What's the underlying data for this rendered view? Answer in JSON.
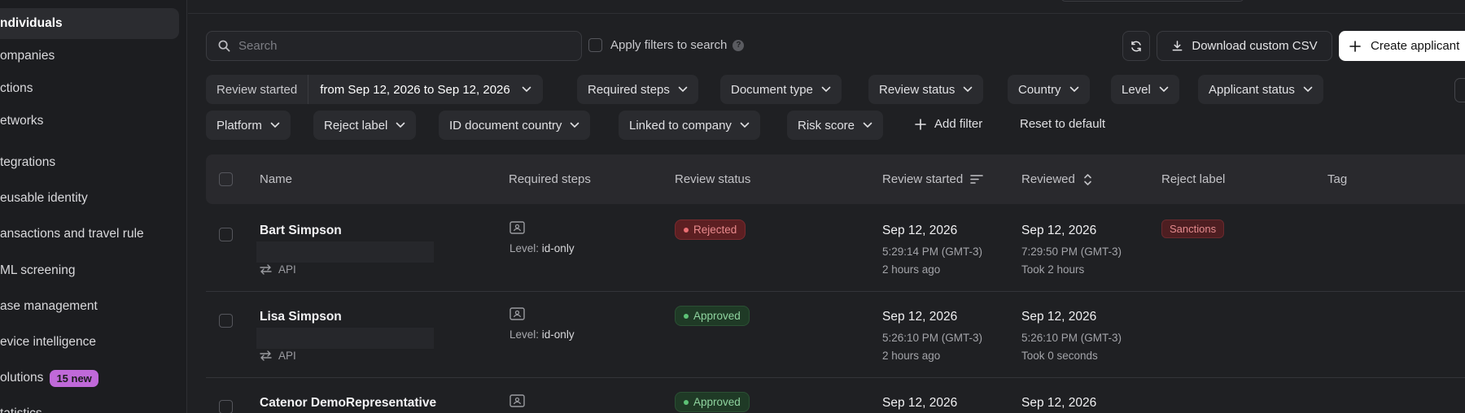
{
  "sidebar": {
    "items": [
      {
        "label": "ndividuals",
        "active": true
      },
      {
        "label": "ompanies"
      },
      {
        "label": "ctions"
      },
      {
        "label": "etworks"
      },
      {
        "label": "tegrations"
      },
      {
        "label": "eusable identity"
      },
      {
        "label": "ansactions and travel rule"
      },
      {
        "label": "ML screening"
      },
      {
        "label": "ase management"
      },
      {
        "label": "evice intelligence"
      },
      {
        "label": "olutions",
        "badge": "15 new"
      },
      {
        "label": "tatistics"
      }
    ]
  },
  "toolbar": {
    "search_placeholder": "Search",
    "apply_filters_label": "Apply filters to search",
    "download_label": "Download custom CSV",
    "create_label": "Create applicant"
  },
  "filters": {
    "review_started_label": "Review started",
    "review_started_value": "from Sep 12, 2026 to Sep 12, 2026",
    "row1": [
      "Required steps",
      "Document type",
      "Review status",
      "Country",
      "Level",
      "Applicant status"
    ],
    "row2": [
      "Platform",
      "Reject label",
      "ID document country",
      "Linked to company",
      "Risk score"
    ],
    "add_filter": "Add filter",
    "reset": "Reset to default"
  },
  "table": {
    "headers": {
      "name": "Name",
      "required_steps": "Required steps",
      "review_status": "Review status",
      "review_started": "Review started",
      "reviewed": "Reviewed",
      "reject_label": "Reject label",
      "tag": "Tag"
    },
    "rows": [
      {
        "name": "Bart Simpson",
        "source": "API",
        "level_label": "Level:",
        "level": "id-only",
        "status": "Rejected",
        "started_date": "Sep 12, 2026",
        "started_time": "5:29:14 PM (GMT-3)",
        "started_ago": "2 hours ago",
        "reviewed_date": "Sep 12, 2026",
        "reviewed_time": "7:29:50 PM (GMT-3)",
        "reviewed_took": "Took 2 hours",
        "reject_label": "Sanctions"
      },
      {
        "name": "Lisa Simpson",
        "source": "API",
        "level_label": "Level:",
        "level": "id-only",
        "status": "Approved",
        "started_date": "Sep 12, 2026",
        "started_time": "5:26:10 PM (GMT-3)",
        "started_ago": "2 hours ago",
        "reviewed_date": "Sep 12, 2026",
        "reviewed_time": "5:26:10 PM (GMT-3)",
        "reviewed_took": "Took 0 seconds"
      },
      {
        "name": "Catenor DemoRepresentative",
        "status": "Approved",
        "started_date": "Sep 12, 2026",
        "reviewed_date": "Sep 12, 2026"
      }
    ]
  },
  "colors": {
    "background": "#1f2023",
    "rejected": "#ea6e73",
    "approved": "#5dc276",
    "badge": "#c069d9"
  }
}
